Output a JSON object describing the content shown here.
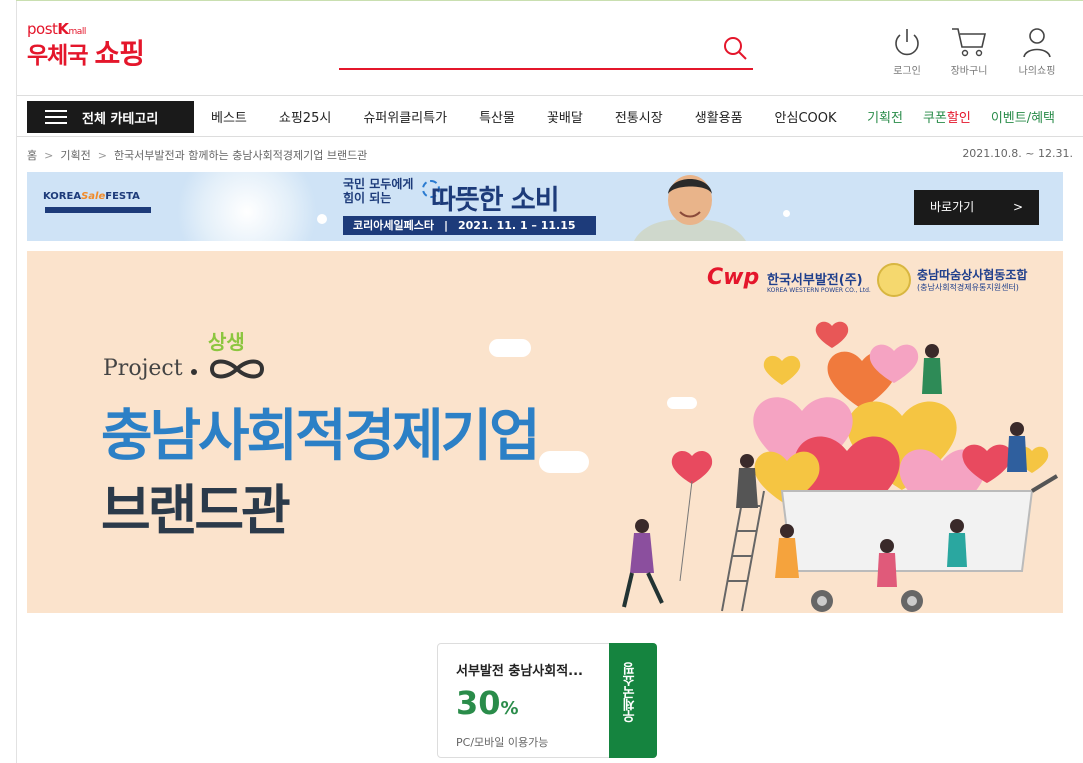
{
  "header": {
    "logo_top": "post",
    "logo_k": "K",
    "logo_mall": "mall",
    "logo_main_a": "우체국",
    "logo_main_b": "쇼핑",
    "search_placeholder": "",
    "utils": [
      {
        "label": "로그인",
        "icon": "power-icon"
      },
      {
        "label": "장바구니",
        "icon": "cart-icon"
      },
      {
        "label": "나의쇼핑",
        "icon": "user-icon"
      }
    ]
  },
  "nav": {
    "all_categories": "전체 카테고리",
    "items": [
      "베스트",
      "쇼핑25시",
      "슈퍼위클리특가",
      "특산물",
      "꽃배달",
      "전통시장",
      "생활용품",
      "안심COOK"
    ],
    "right": {
      "planning": "기획전",
      "coupon_a": "쿠폰",
      "coupon_b": "할인",
      "event": "이벤트/혜택"
    }
  },
  "breadcrumb": {
    "home": "홈",
    "level1": "기획전",
    "level2": "한국서부발전과 함께하는 충남사회적경제기업 브랜드관",
    "date_range": "2021.10.8. ~ 12.31."
  },
  "promo": {
    "korea": "KOREA",
    "sale": "Sale",
    "festa": "FESTA",
    "line1": "국민 모두에게",
    "line2": "힘이 되는",
    "big": "따뜻한 소비",
    "date_name": "코리아세일페스타",
    "date_range": "2021. 11. 1 – 11.15",
    "goto_label": "바로가기",
    "goto_arrow": ">"
  },
  "hero": {
    "cwp_mark": "Cwp",
    "cwp_name": "한국서부발전(주)",
    "cwp_sub": "KOREA WESTERN POWER CO., Ltd.",
    "coop_name": "충남따숨상사협동조합",
    "coop_sub": "(충남사회적경제유통지원센터)",
    "project": "Project",
    "mark": "상생",
    "title": "충남사회적경제기업",
    "subtitle": "브랜드관"
  },
  "coupon": {
    "title": "서부발전 충남사회적...",
    "percent": "30",
    "unit": "%",
    "note": "PC/모바일 이용가능",
    "stub": "우체국쇼핑"
  },
  "colors": {
    "brand_red": "#e4162b",
    "green": "#2a8c4a",
    "hero_bg": "#fbe3cc",
    "hero_title": "#2c80c6",
    "promo_bg": "#cfe3f6"
  }
}
